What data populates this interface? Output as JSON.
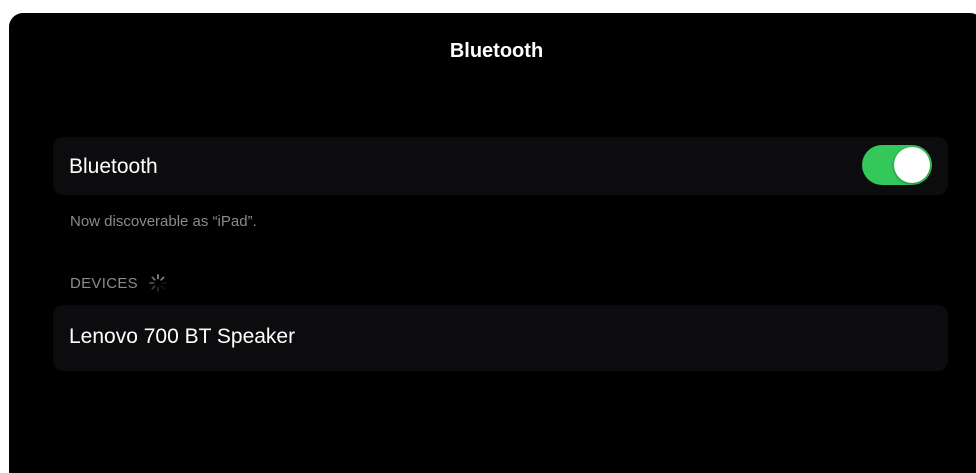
{
  "header": {
    "title": "Bluetooth"
  },
  "bluetooth_row": {
    "label": "Bluetooth",
    "enabled": true
  },
  "discoverable_note": "Now discoverable as “iPad”.",
  "devices_section": {
    "header": "DEVICES",
    "spinner_icon": "activity-spinner-icon",
    "devices": [
      {
        "name": "Lenovo 700 BT Speaker"
      }
    ]
  },
  "colors": {
    "toggle_on": "#34c759",
    "background": "#000000",
    "secondary_text": "#8a8a8f"
  }
}
